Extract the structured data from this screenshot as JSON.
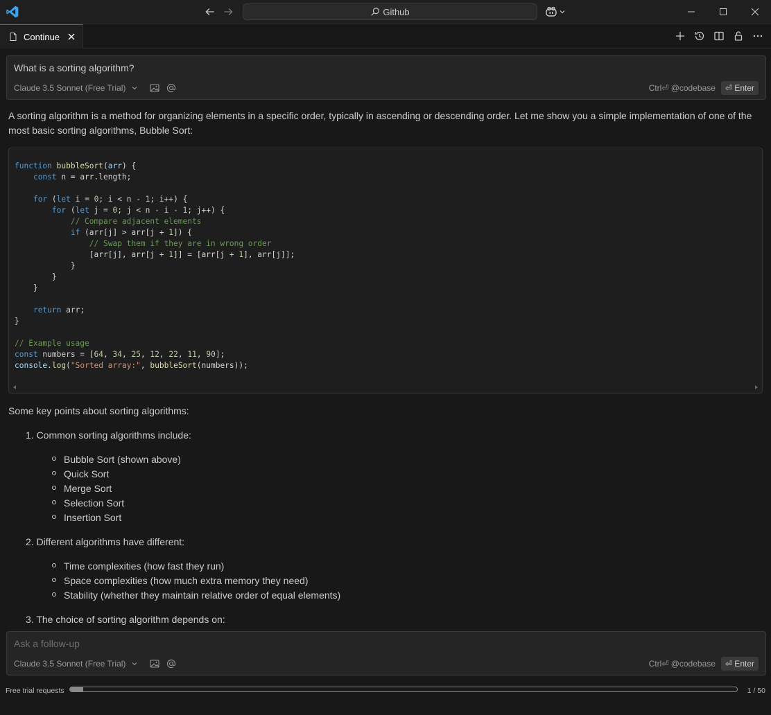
{
  "titlebar": {
    "search_label": "Github",
    "icons": [
      "vscode-logo",
      "arrow-left-icon",
      "arrow-right-icon",
      "search-icon",
      "copilot-icon",
      "chevron-down-icon",
      "minimize-icon",
      "maximize-icon",
      "close-icon"
    ]
  },
  "tab": {
    "label": "Continue",
    "actions": [
      "plus-icon",
      "history-icon",
      "split-icon",
      "lock-icon",
      "more-icon"
    ]
  },
  "prompt": {
    "question": "What is a sorting algorithm?",
    "model": "Claude 3.5 Sonnet (Free Trial)",
    "shortcut": "Ctrl⏎ @codebase",
    "enter": "⏎ Enter"
  },
  "response": {
    "intro": "A sorting algorithm is a method for organizing elements in a specific order, typically in ascending or descending order. Let me show you a simple implementation of one of the most basic sorting algorithms, Bubble Sort:",
    "code_lines": [
      "function bubbleSort(arr) {",
      "    const n = arr.length;",
      "",
      "    for (let i = 0; i < n - 1; i++) {",
      "        for (let j = 0; j < n - i - 1; j++) {",
      "            // Compare adjacent elements",
      "            if (arr[j] > arr[j + 1]) {",
      "                // Swap them if they are in wrong order",
      "                [arr[j], arr[j + 1]] = [arr[j + 1], arr[j]];",
      "            }",
      "        }",
      "    }",
      "",
      "    return arr;",
      "}",
      "",
      "// Example usage",
      "const numbers = [64, 34, 25, 12, 22, 11, 90];",
      "console.log(\"Sorted array:\", bubbleSort(numbers));"
    ],
    "key_points": "Some key points about sorting algorithms:",
    "item1": "1. Common sorting algorithms include:",
    "item1_list": [
      "Bubble Sort (shown above)",
      "Quick Sort",
      "Merge Sort",
      "Selection Sort",
      "Insertion Sort"
    ],
    "item2": "2. Different algorithms have different:",
    "item2_list": [
      "Time complexities (how fast they run)",
      "Space complexities (how much extra memory they need)",
      "Stability (whether they maintain relative order of equal elements)"
    ],
    "item3": "3. The choice of sorting algorithm depends on:"
  },
  "followup": {
    "placeholder": "Ask a follow-up",
    "model": "Claude 3.5 Sonnet (Free Trial)",
    "shortcut": "Ctrl⏎ @codebase",
    "enter": "⏎ Enter"
  },
  "status": {
    "label": "Free trial requests",
    "count": "1 / 50",
    "progress_fraction": 0.02
  }
}
